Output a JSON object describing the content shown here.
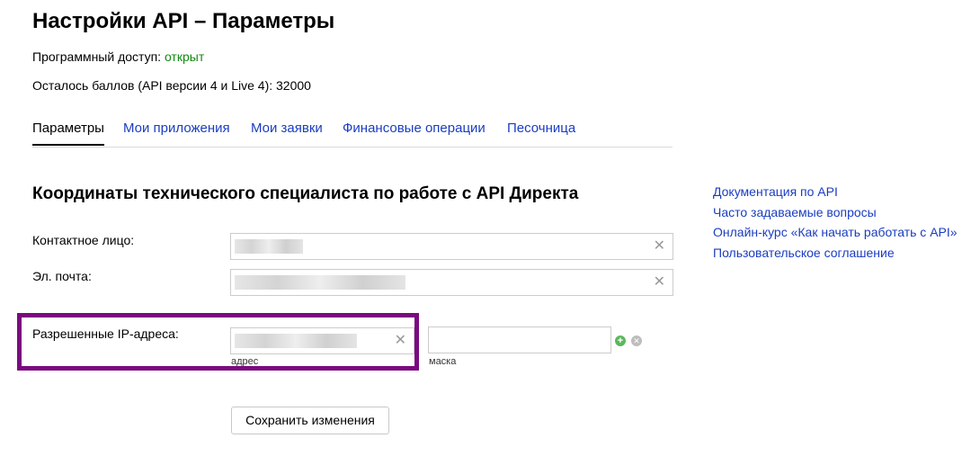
{
  "page": {
    "title": "Настройки API – Параметры",
    "access_label": "Программный доступ:",
    "access_value": "открыт",
    "points_text": "Осталось баллов (API версии 4 и Live 4): 32000"
  },
  "tabs": [
    {
      "label": "Параметры",
      "active": true
    },
    {
      "label": "Мои приложения"
    },
    {
      "label": "Мои заявки"
    },
    {
      "label": "Финансовые операции"
    },
    {
      "label": "Песочница"
    }
  ],
  "section": {
    "title": "Координаты технического специалиста по работе с API Директа",
    "contact_label": "Контактное лицо:",
    "email_label": "Эл. почта:",
    "ip_label": "Разрешенные IP-адреса:",
    "ip_address_caption": "адрес",
    "ip_mask_caption": "маска",
    "clear_symbol": "✕",
    "add_symbol": "+",
    "remove_symbol": "✕",
    "save_label": "Сохранить изменения"
  },
  "sidebar_links": [
    "Документация по API",
    "Часто задаваемые вопросы",
    "Онлайн-курс «Как начать работать с API»",
    "Пользовательское соглашение"
  ],
  "colors": {
    "link": "#1a3dc1",
    "status_open": "#118a0f",
    "highlight_frame": "#7a0a7f"
  }
}
